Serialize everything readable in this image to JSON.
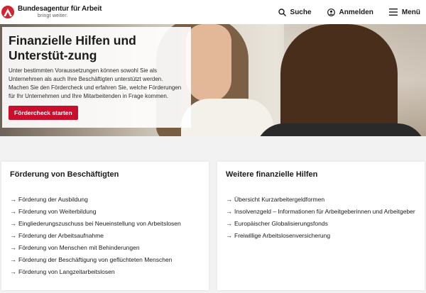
{
  "header": {
    "logo_title": "Bundesagentur für Arbeit",
    "logo_tagline": "bringt weiter.",
    "nav": {
      "search": "Suche",
      "login": "Anmelden",
      "menu": "Menü"
    }
  },
  "hero": {
    "title": "Finanzielle Hilfen und Unterstüt-zung",
    "text": "Unter bestimmten Voraussetzungen können sowohl Sie als Unternehmen als auch Ihre Beschäftigten unterstützt werden. Machen Sie den Fördercheck und erfahren Sie, welche Förderungen für Ihr Unternehmen und Ihre Mitarbeitenden in Frage kommen.",
    "button": "Fördercheck starten"
  },
  "cards": {
    "left": {
      "title": "Förderung von Beschäftigten",
      "items": [
        "Förderung der Ausbildung",
        "Förderung von Weiterbildung",
        "Eingliederungszuschuss bei Neueinstellung von Arbeitslosen",
        "Förderung der Arbeitsaufnahme",
        "Förderung von Menschen mit Behinderungen",
        "Förderung der Beschäftigung von geflüchteten Menschen",
        "Förderung von Langzeitarbeitslosen"
      ]
    },
    "right": {
      "title": "Weitere finanzielle Hilfen",
      "items": [
        "Übersicht Kurzarbeitergeldformen",
        "Insolvenzgeld – Informationen für Arbeitgeberinnen und Arbeitgeber",
        "Europäischer Globalisierungsfonds",
        "Freiwillige Arbeitslosenversicherung"
      ]
    }
  },
  "colors": {
    "brand_red": "#c8102e",
    "logo_red": "#d2232f"
  }
}
